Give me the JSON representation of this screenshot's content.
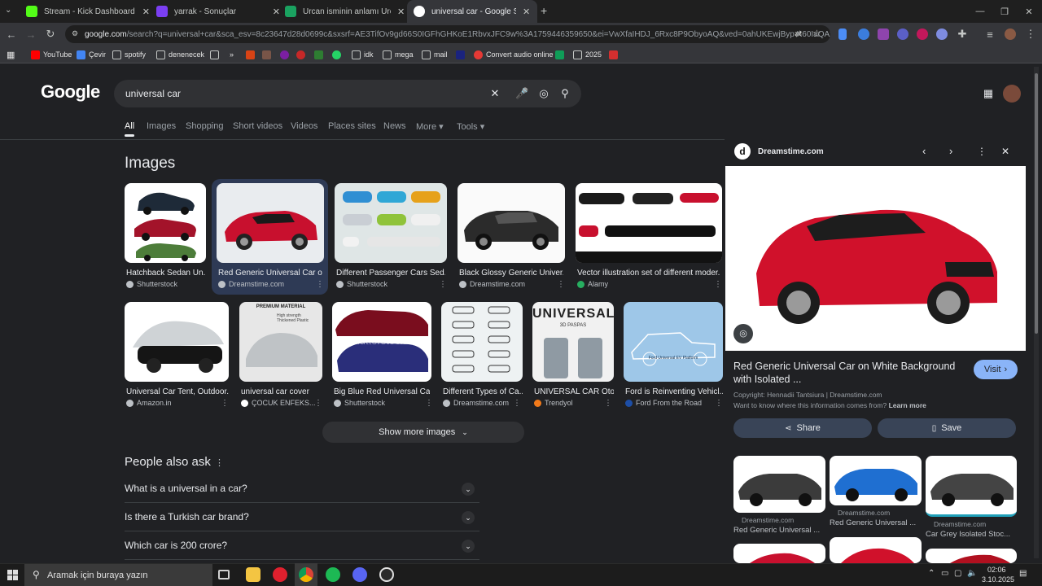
{
  "tabs": [
    {
      "title": "Stream - Kick Dashboard",
      "color": "#53fc18"
    },
    {
      "title": "yarrak - Sonuçlar",
      "color": "#7b3ff2"
    },
    {
      "title": "Urcan isminin anlamı Urcan ne",
      "color": "#1aa260"
    },
    {
      "title": "universal car - Google Search",
      "color": "#ffffff"
    }
  ],
  "new_tab": "+",
  "window_controls": {
    "minimize": "—",
    "restore": "❐",
    "close": "✕"
  },
  "address": {
    "host": "google.com",
    "rest": "/search?q=universal+car&sca_esv=8c23647d28d0699c&sxsrf=AE3TifOv9gd66S0IGFhGHKoE1RbvxJFC9w%3A1759446359650&ei=VwXfaIHDJ_6Rxc8P9ObyoAQ&ved=0ahUKEwjByp K60IaQAxX-SPED..."
  },
  "bookmarks": [
    "YouTube",
    "Çevir",
    "spotify",
    "denenecek",
    "",
    "»",
    "",
    "",
    "",
    "",
    "",
    "idk",
    "mega",
    "mail",
    "",
    "Convert audio online",
    "",
    "2025",
    ""
  ],
  "search": {
    "query": "universal car",
    "logo": "Google"
  },
  "nav_tabs": [
    "All",
    "Images",
    "Shopping",
    "Short videos",
    "Videos",
    "Places sites",
    "News",
    "More ▾",
    "Tools ▾"
  ],
  "images_heading": "Images",
  "row1": [
    {
      "caption": "Hatchback Sedan Un...",
      "source": "Shutterstock"
    },
    {
      "caption": "Red Generic Universal Car o...",
      "source": "Dreamstime.com"
    },
    {
      "caption": "Different Passenger Cars Sed...",
      "source": "Shutterstock"
    },
    {
      "caption": "Black Glossy Generic Univer...",
      "source": "Dreamstime.com"
    },
    {
      "caption": "Vector illustration set of different moder...",
      "source": "Alamy"
    }
  ],
  "row2": [
    {
      "caption": "Universal Car Tent, Outdoor...",
      "source": "Amazon.in"
    },
    {
      "caption": "universal car cover",
      "source": "ÇOCUK ENFEKS..."
    },
    {
      "caption": "Big Blue Red Universal Ca...",
      "source": "Shutterstock"
    },
    {
      "caption": "Different Types of Ca...",
      "source": "Dreamstime.com"
    },
    {
      "caption": "UNIVERSAL CAR Oto...",
      "source": "Trendyol"
    },
    {
      "caption": "Ford is Reinventing Vehicl...",
      "source": "Ford From the Road"
    }
  ],
  "image_texts": {
    "premium": "PREMIUM MATERIAL",
    "premium_sub": "High strength Thickened Plastic",
    "universal": "UNIVERSAL",
    "paspas": "3D PASPAS",
    "ford_platform": "Ford Universal EV Platform",
    "shutterstock_wm": "shutterstock"
  },
  "show_more": "Show more images",
  "paa": {
    "title": "People also ask",
    "questions": [
      "What is a universal in a car?",
      "Is there a Turkish car brand?",
      "Which car is 200 crore?"
    ]
  },
  "panel": {
    "site": "Dreamstime.com",
    "title": "Red Generic Universal Car on White Background with Isolated ...",
    "visit": "Visit",
    "copyright": "Copyright: Hennadii Tantsiura | Dreamstime.com",
    "info_q": "Want to know where this information comes from?",
    "learn_more": "Learn more",
    "share": "Share",
    "save": "Save",
    "related": [
      {
        "source": "Dreamstime.com",
        "caption": "Red Generic Universal ..."
      },
      {
        "source": "Dreamstime.com",
        "caption": "Red Generic Universal ..."
      },
      {
        "source": "Dreamstime.com",
        "caption": "Car Grey Isolated Stoc..."
      }
    ]
  },
  "taskbar": {
    "search_placeholder": "Aramak için buraya yazın",
    "time": "02:06",
    "date": "3.10.2025"
  }
}
